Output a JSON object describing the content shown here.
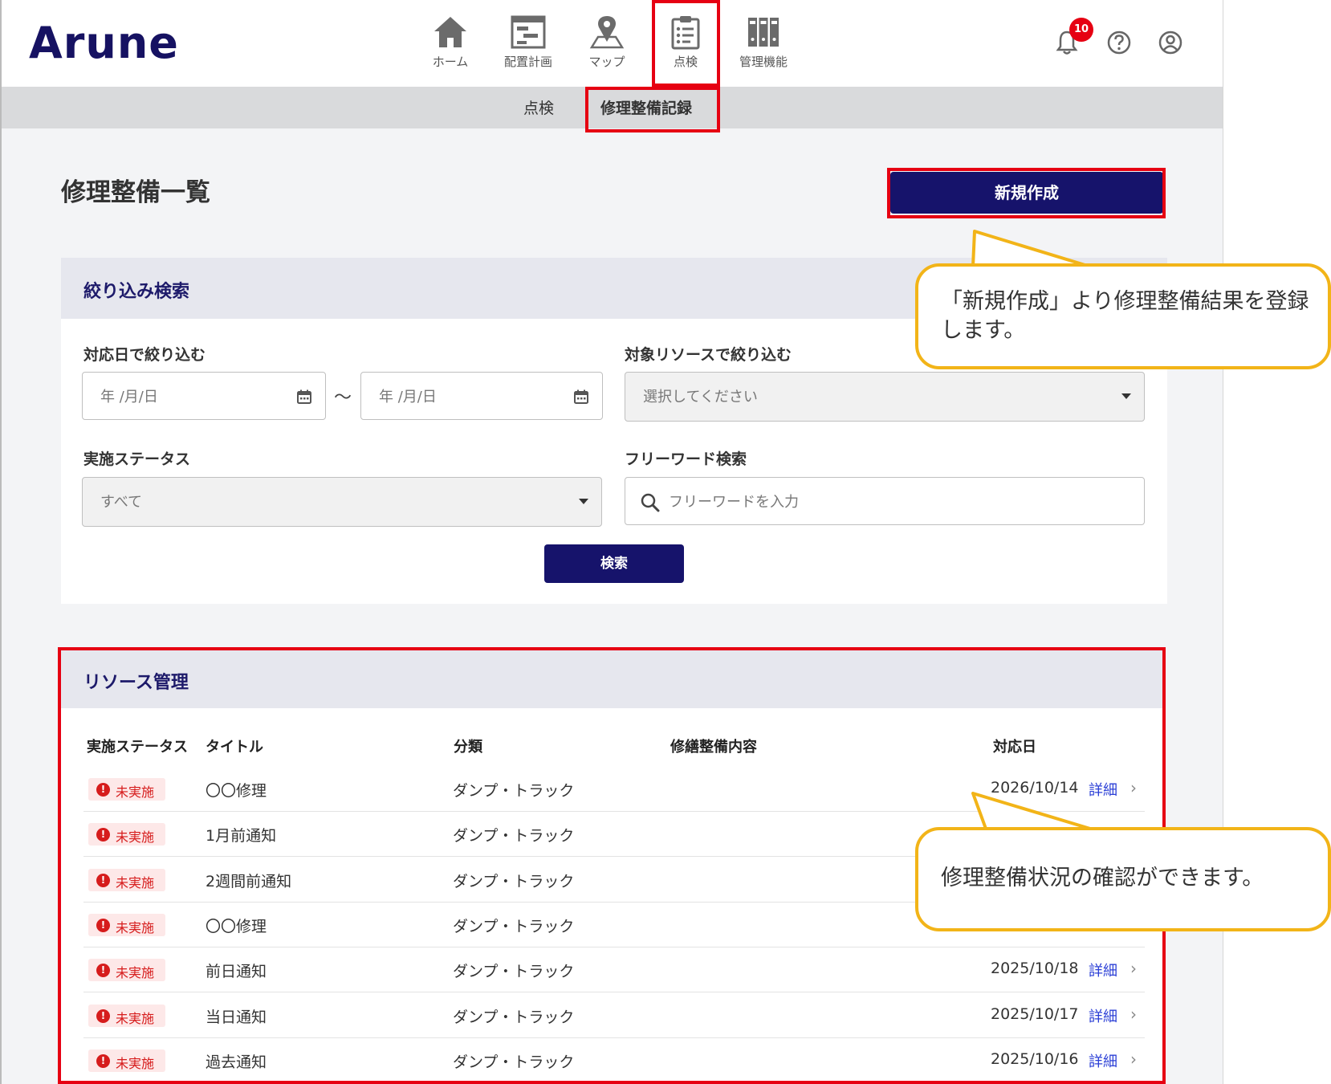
{
  "header": {
    "logo": "Arune",
    "nav": [
      {
        "label": "ホーム",
        "icon": "home-icon"
      },
      {
        "label": "配置計画",
        "icon": "layout-plan-icon"
      },
      {
        "label": "マップ",
        "icon": "map-pin-icon"
      },
      {
        "label": "点検",
        "icon": "clipboard-icon"
      },
      {
        "label": "管理機能",
        "icon": "binders-icon"
      }
    ],
    "notification_count": "10",
    "icons": [
      "bell-icon",
      "help-icon",
      "account-icon"
    ]
  },
  "subnav": {
    "items": [
      "点検",
      "修理整備記録"
    ]
  },
  "page": {
    "title": "修理整備一覧",
    "new_button": "新規作成"
  },
  "filter": {
    "title": "絞り込み検索",
    "date_label": "対応日で絞り込む",
    "date_from_placeholder": "年 /月/日",
    "date_sep": "〜",
    "date_to_placeholder": "年 /月/日",
    "resource_label": "対象リソースで絞り込む",
    "resource_placeholder": "選択してください",
    "status_label": "実施ステータス",
    "status_value": "すべて",
    "freeword_label": "フリーワード検索",
    "freeword_placeholder": "フリーワードを入力",
    "search_button": "検索"
  },
  "table": {
    "title": "リソース管理",
    "columns": [
      "実施ステータス",
      "タイトル",
      "分類",
      "修繕整備内容",
      "対応日"
    ],
    "rows": [
      {
        "status": "未実施",
        "title": "〇〇修理",
        "category": "ダンプ・トラック",
        "date": "2026/10/14",
        "link": "詳細"
      },
      {
        "status": "未実施",
        "title": "1月前通知",
        "category": "ダンプ・トラック",
        "date": "",
        "link": ""
      },
      {
        "status": "未実施",
        "title": "2週間前通知",
        "category": "ダンプ・トラック",
        "date": "",
        "link": ""
      },
      {
        "status": "未実施",
        "title": "〇〇修理",
        "category": "ダンプ・トラック",
        "date": "",
        "link": ""
      },
      {
        "status": "未実施",
        "title": "前日通知",
        "category": "ダンプ・トラック",
        "date": "2025/10/18",
        "link": "詳細"
      },
      {
        "status": "未実施",
        "title": "当日通知",
        "category": "ダンプ・トラック",
        "date": "2025/10/17",
        "link": "詳細"
      },
      {
        "status": "未実施",
        "title": "過去通知",
        "category": "ダンプ・トラック",
        "date": "2025/10/16",
        "link": "詳細"
      }
    ]
  },
  "callouts": {
    "new": "「新規作成」より修理整備結果を登録します。",
    "list": "修理整備状況の確認ができます。"
  },
  "colors": {
    "brand": "#161262",
    "highlight": "#e60012",
    "callout_border": "#f2b418",
    "status_red": "#d61c1c",
    "link": "#2b3fd6"
  }
}
